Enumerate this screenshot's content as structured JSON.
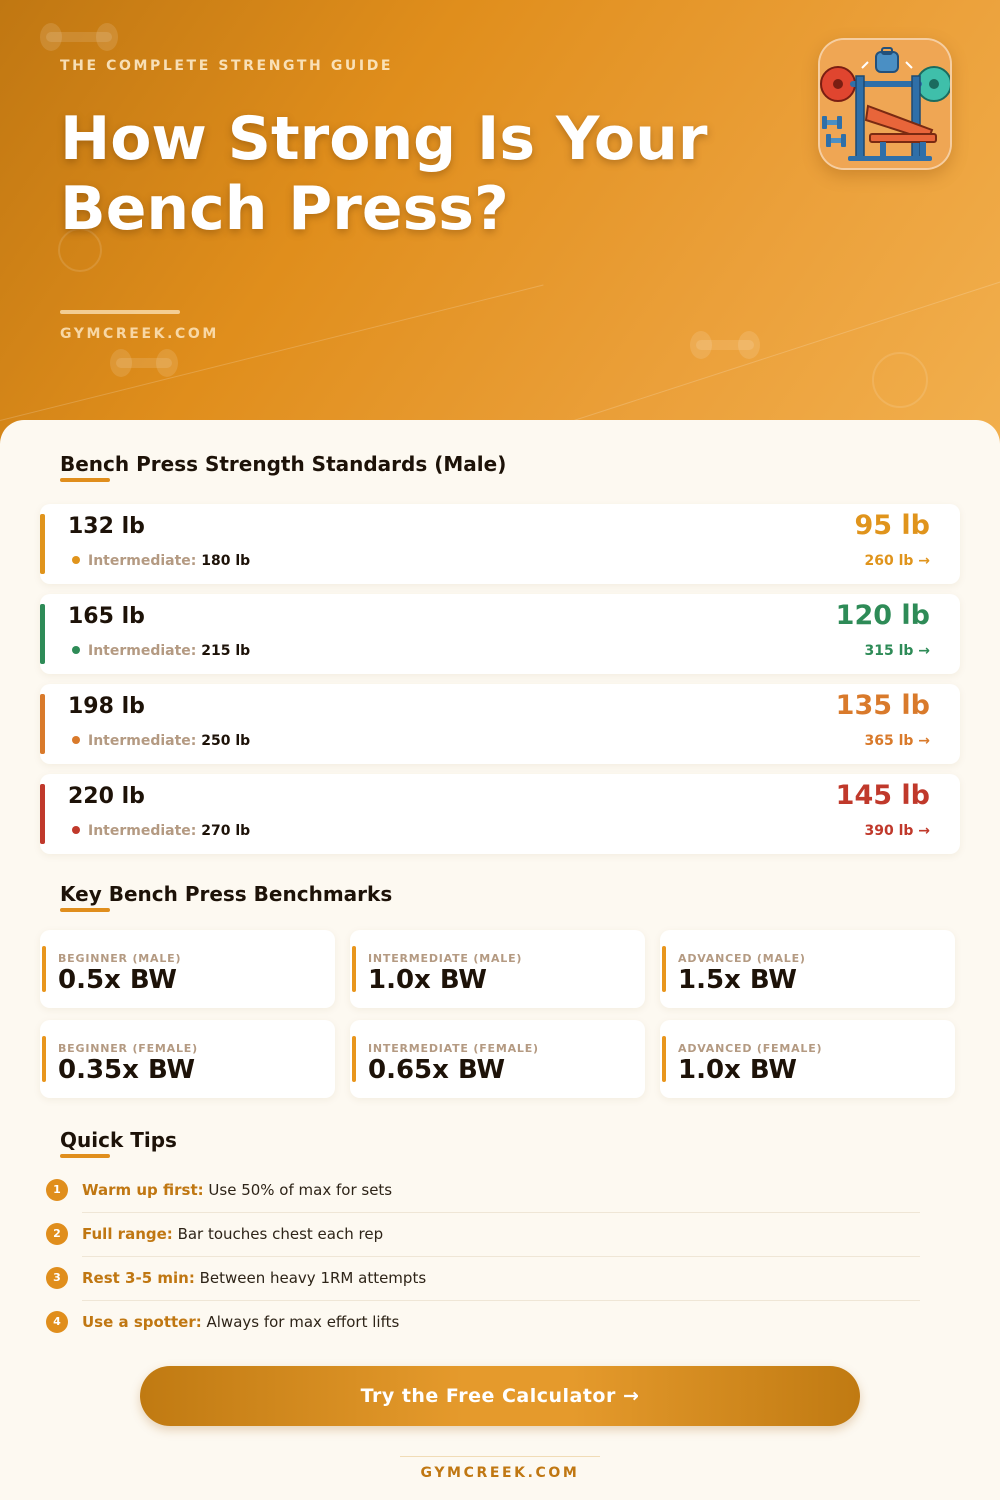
{
  "header": {
    "eyebrow": "THE COMPLETE STRENGTH GUIDE",
    "title_line1": "How Strong Is Your",
    "title_line2": "Bench Press?",
    "site": "GYMCREEK.COM"
  },
  "standards": {
    "title": "Bench Press Strength Standards (Male)",
    "intermediate_label": "Intermediate:",
    "rows": [
      {
        "bodyweight": "132 lb",
        "intermediate": "180 lb",
        "beginner": "95 lb",
        "advanced": "260 lb →",
        "color": "#e0941c"
      },
      {
        "bodyweight": "165 lb",
        "intermediate": "215 lb",
        "beginner": "120 lb",
        "advanced": "315 lb →",
        "color": "#2e8b57"
      },
      {
        "bodyweight": "198 lb",
        "intermediate": "250 lb",
        "beginner": "135 lb",
        "advanced": "365 lb →",
        "color": "#d97a2b"
      },
      {
        "bodyweight": "220 lb",
        "intermediate": "270 lb",
        "beginner": "145 lb",
        "advanced": "390 lb →",
        "color": "#c0392b"
      }
    ]
  },
  "benchmarks": {
    "title": "Key Bench Press Benchmarks",
    "items": [
      {
        "label": "BEGINNER (MALE)",
        "value": "0.5x BW"
      },
      {
        "label": "INTERMEDIATE (MALE)",
        "value": "1.0x BW"
      },
      {
        "label": "ADVANCED (MALE)",
        "value": "1.5x BW"
      },
      {
        "label": "BEGINNER (FEMALE)",
        "value": "0.35x BW"
      },
      {
        "label": "INTERMEDIATE (FEMALE)",
        "value": "0.65x BW"
      },
      {
        "label": "ADVANCED (FEMALE)",
        "value": "1.0x BW"
      }
    ]
  },
  "tips": {
    "title": "Quick Tips",
    "items": [
      {
        "num": "1",
        "bold": "Warm up first:",
        "text": " Use 50% of max for sets"
      },
      {
        "num": "2",
        "bold": "Full range:",
        "text": " Bar touches chest each rep"
      },
      {
        "num": "3",
        "bold": "Rest 3-5 min:",
        "text": " Between heavy 1RM attempts"
      },
      {
        "num": "4",
        "bold": "Use a spotter:",
        "text": " Always for max effort lifts"
      }
    ]
  },
  "cta": {
    "label": "Try the Free Calculator →"
  },
  "footer": {
    "site": "GYMCREEK.COM"
  },
  "icons": {
    "logo": "bench-press-icon"
  }
}
